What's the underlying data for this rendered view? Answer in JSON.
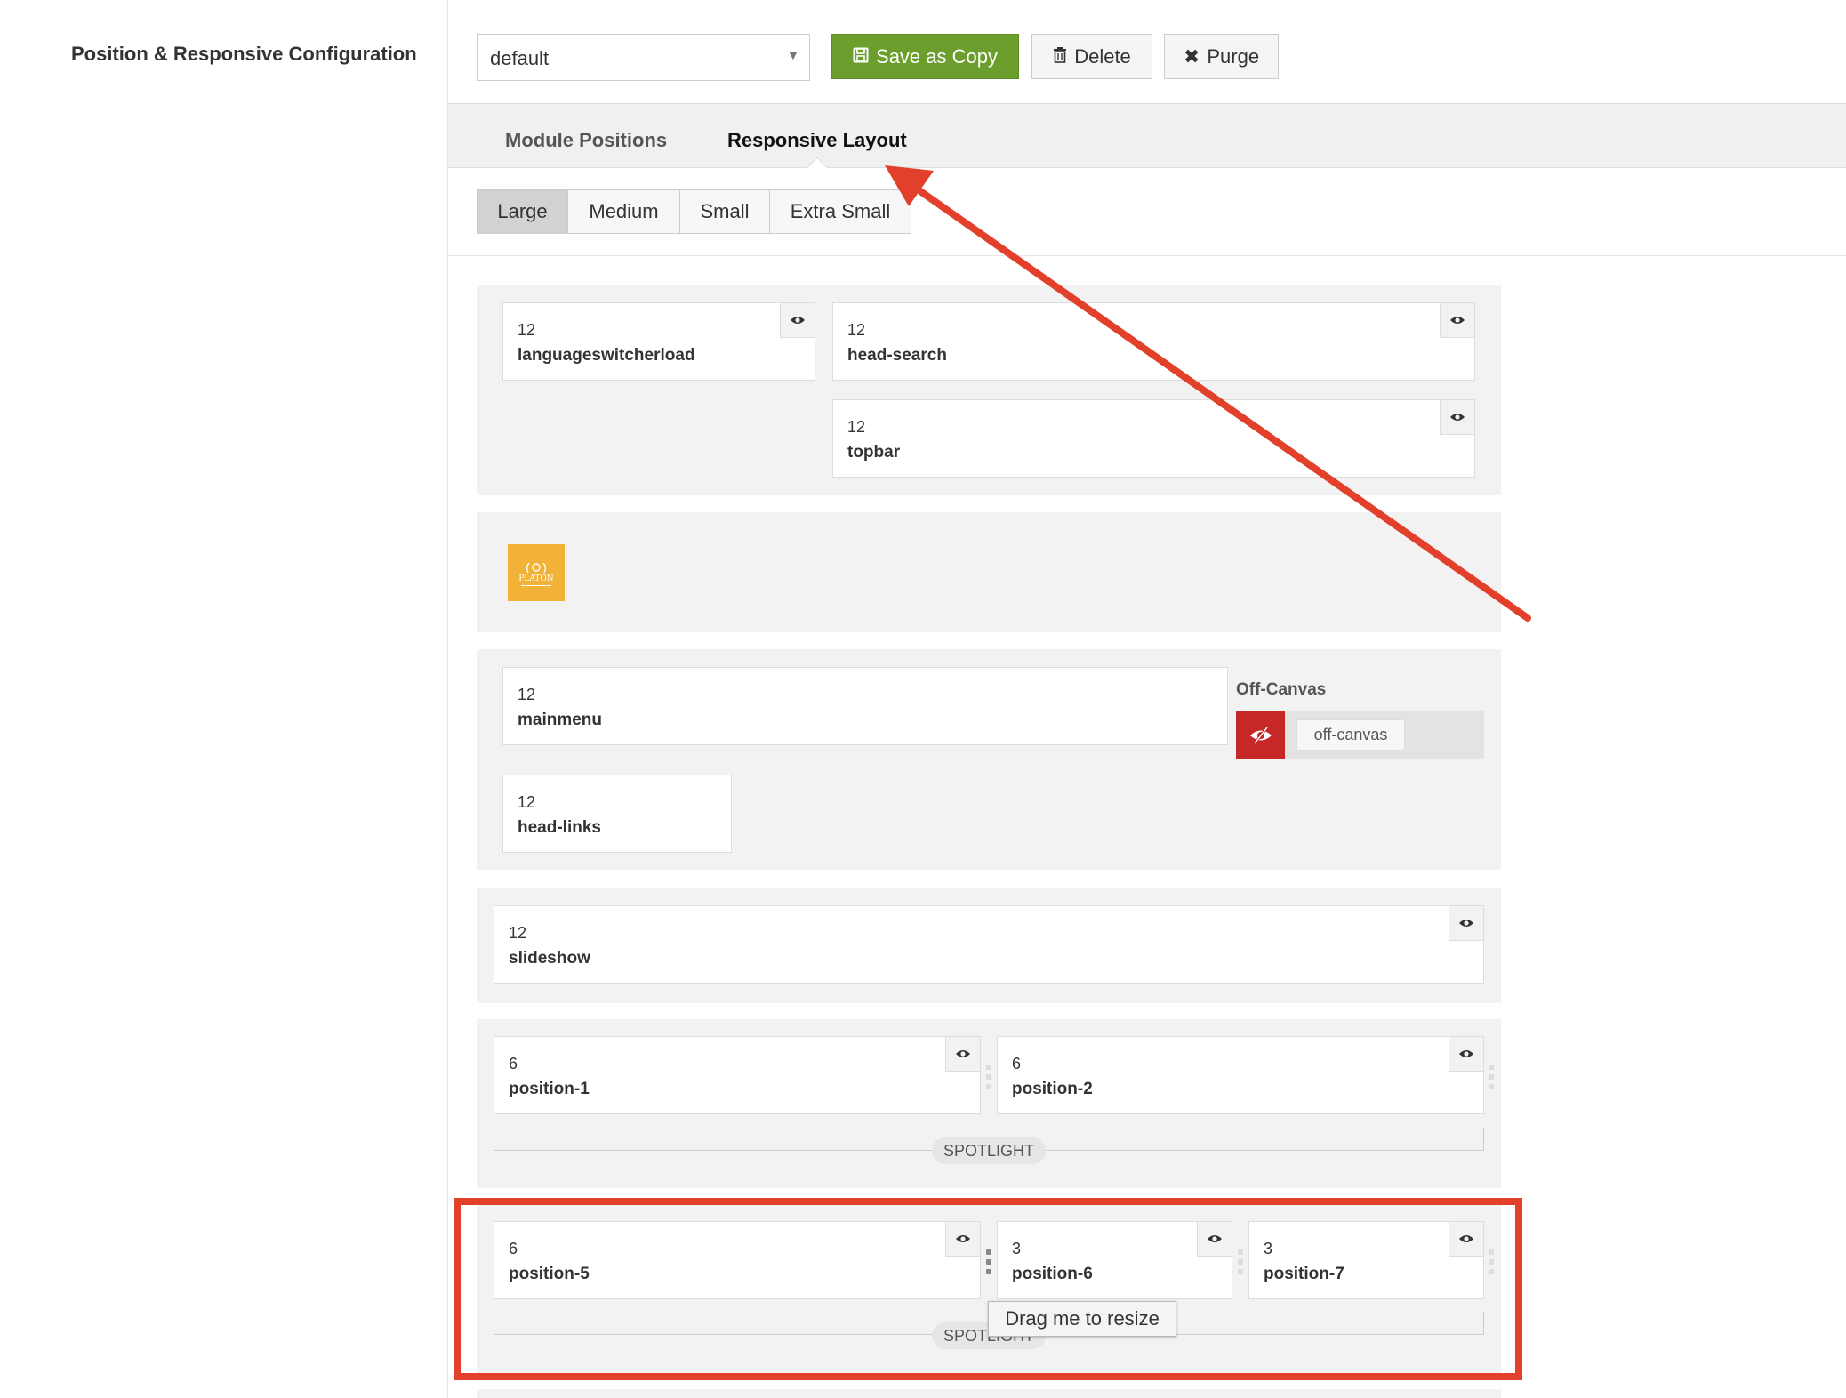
{
  "section": {
    "label": "Position & Responsive Configuration"
  },
  "toolbar": {
    "select_value": "default",
    "save_label": "Save as Copy",
    "delete_label": "Delete",
    "purge_label": "Purge"
  },
  "tabs": [
    {
      "label": "Module Positions"
    },
    {
      "label": "Responsive Layout",
      "active": true
    }
  ],
  "devices": [
    {
      "label": "Large",
      "active": true
    },
    {
      "label": "Medium"
    },
    {
      "label": "Small"
    },
    {
      "label": "Extra Small"
    }
  ],
  "rows": {
    "header": {
      "languageswitcherload": {
        "num": "12",
        "name": "languageswitcherload"
      },
      "head_search": {
        "num": "12",
        "name": "head-search"
      },
      "topbar": {
        "num": "12",
        "name": "topbar"
      }
    },
    "logo": {
      "line1": "PLATON"
    },
    "nav": {
      "mainmenu": {
        "num": "12",
        "name": "mainmenu"
      },
      "head_links": {
        "num": "12",
        "name": "head-links"
      },
      "offcanvas_label": "Off-Canvas",
      "offcanvas_chip": "off-canvas"
    },
    "slideshow": {
      "num": "12",
      "name": "slideshow"
    },
    "spotlight1": {
      "p1": {
        "num": "6",
        "name": "position-1"
      },
      "p2": {
        "num": "6",
        "name": "position-2"
      },
      "badge": "SPOTLIGHT"
    },
    "spotlight2": {
      "p5": {
        "num": "6",
        "name": "position-5"
      },
      "p6": {
        "num": "3",
        "name": "position-6"
      },
      "p7": {
        "num": "3",
        "name": "position-7"
      },
      "badge": "SPOTLIGHT"
    }
  },
  "tooltip": "Drag me to resize",
  "colors": {
    "save_green": "#6b9e2c",
    "annotation_red": "#e3402c",
    "offcanvas_red": "#c62828",
    "logo_gold": "#f2b137"
  }
}
